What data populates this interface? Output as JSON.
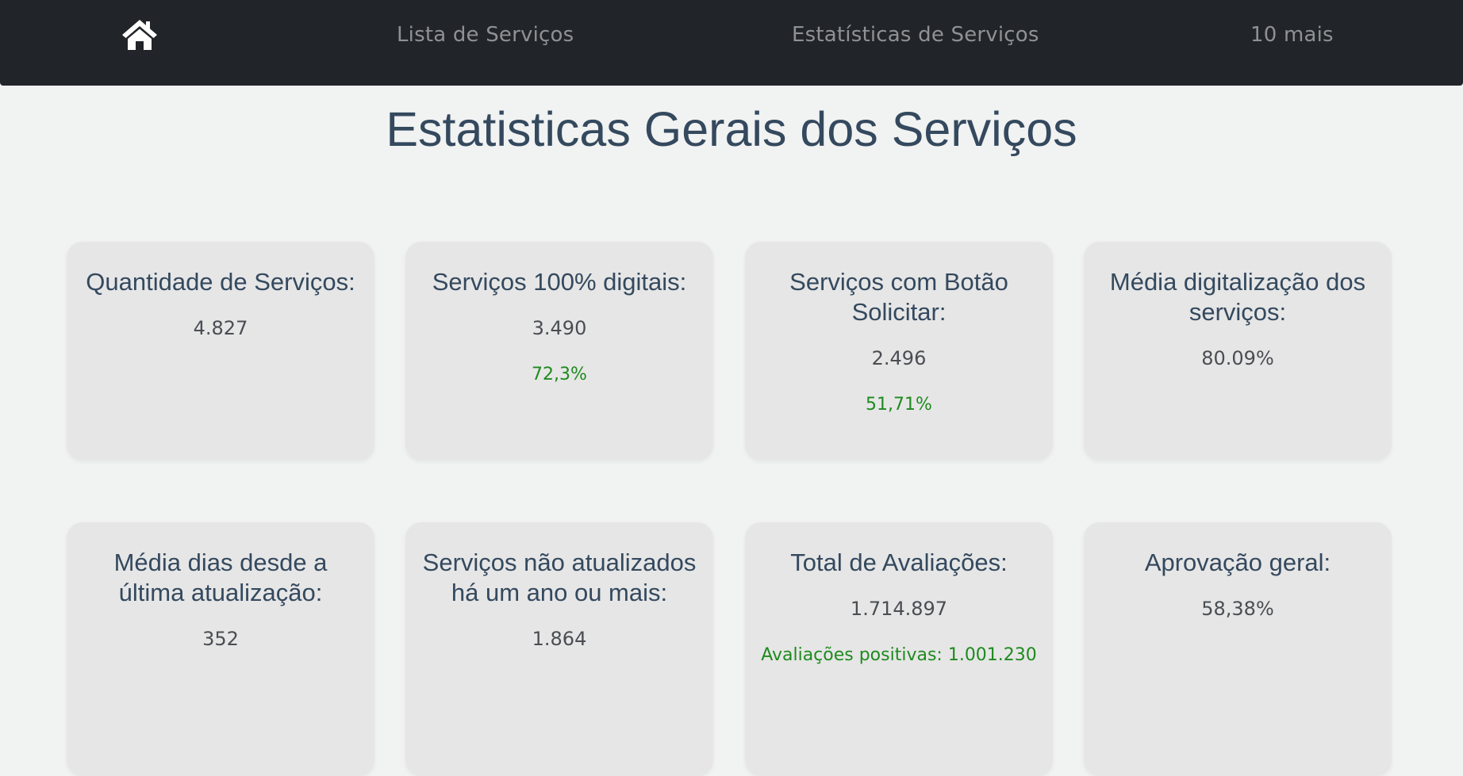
{
  "navbar": {
    "home_icon": "home-icon",
    "links": [
      "Lista de Serviços",
      "Estatísticas de Serviços",
      "10 mais"
    ]
  },
  "page_title": "Estatisticas Gerais dos Serviços",
  "cards": [
    {
      "title": "Quantidade de Serviços:",
      "value": "4.827"
    },
    {
      "title": "Serviços 100% digitais:",
      "value": "3.490",
      "extra": "72,3%"
    },
    {
      "title": "Serviços com Botão Solicitar:",
      "value": "2.496",
      "extra": "51,71%"
    },
    {
      "title": "Média digitalização dos serviços:",
      "value": "80.09%"
    },
    {
      "title": "Média dias desde a última atualização:",
      "value": "352"
    },
    {
      "title": "Serviços não atualizados há um ano ou mais:",
      "value": "1.864"
    },
    {
      "title": "Total de Avaliações:",
      "value": "1.714.897",
      "extra": "Avaliações positivas: 1.001.230"
    },
    {
      "title": "Aprovação geral:",
      "value": "58,38%"
    }
  ],
  "colors": {
    "navbar_bg": "#212529",
    "page_bg": "#f1f2f2",
    "card_bg": "#e6e6e6",
    "title_text": "#34495e",
    "positive_text": "#1e8a1e"
  }
}
